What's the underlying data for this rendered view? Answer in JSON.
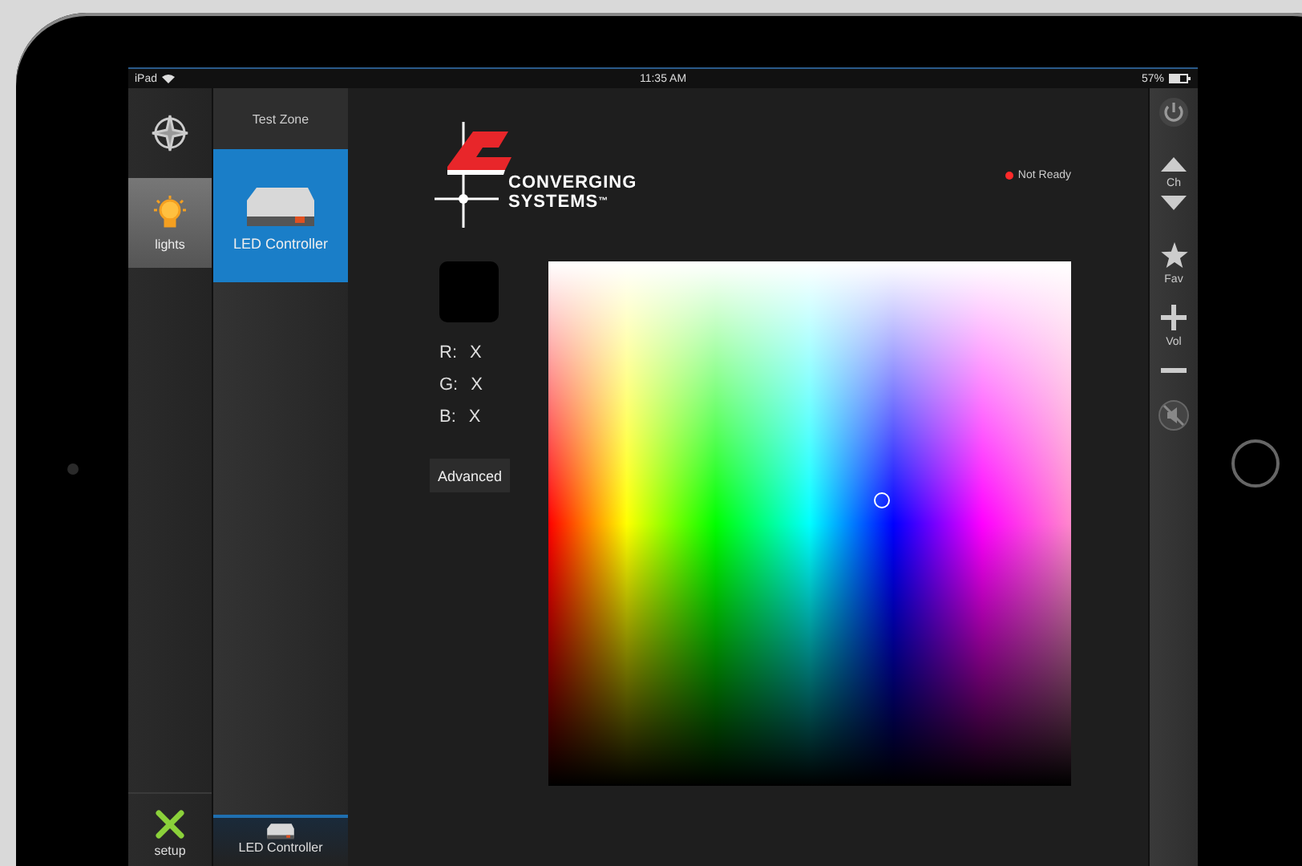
{
  "status_bar": {
    "device": "iPad",
    "time": "11:35 AM",
    "battery": "57%"
  },
  "nav": {
    "items": [
      {
        "kind": "compass",
        "selected": false
      },
      {
        "kind": "lights",
        "label": "lights",
        "selected": true
      }
    ],
    "footer": {
      "kind": "setup",
      "label": "setup"
    }
  },
  "zones": {
    "title": "Test Zone",
    "devices": [
      {
        "label": "LED Controller",
        "selected": true
      }
    ],
    "footer_device": {
      "label": "LED Controller"
    }
  },
  "main": {
    "logo": {
      "line1": "CONVERGING",
      "line2": "SYSTEMS",
      "mark": "™"
    },
    "status": {
      "label": "Not Ready",
      "color": "#ff2a2a"
    },
    "rgb": [
      {
        "channel": "R:",
        "value": "X"
      },
      {
        "channel": "G:",
        "value": "X"
      },
      {
        "channel": "B:",
        "value": "X"
      }
    ],
    "advanced_button": "Advanced"
  },
  "toolbar": [
    {
      "kind": "power"
    },
    {
      "kind": "up"
    },
    {
      "kind": "label",
      "label": "Ch"
    },
    {
      "kind": "down"
    },
    {
      "kind": "star"
    },
    {
      "kind": "label",
      "label": "Fav"
    },
    {
      "kind": "plus"
    },
    {
      "kind": "label",
      "label": "Vol"
    },
    {
      "kind": "minus"
    },
    {
      "kind": "mute"
    }
  ]
}
